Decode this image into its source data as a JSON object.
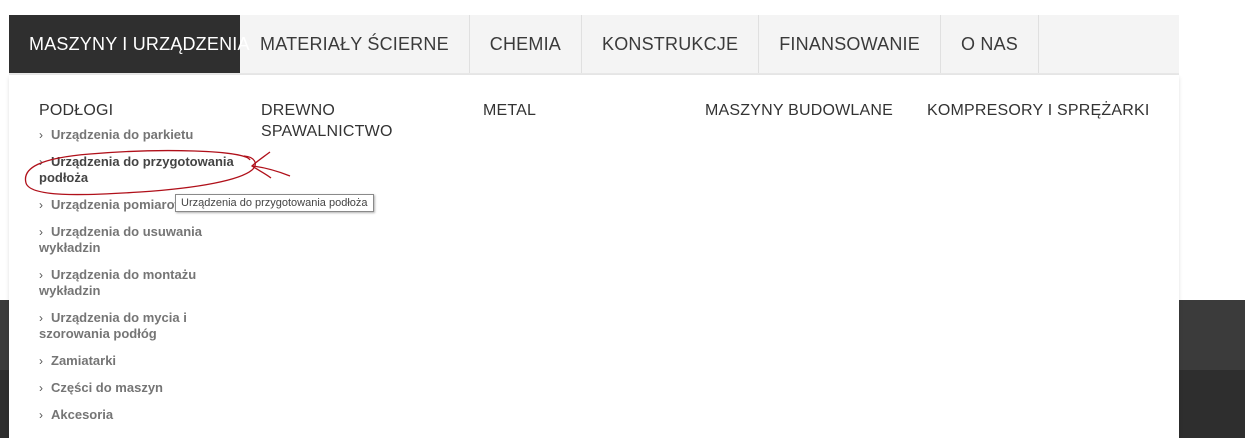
{
  "nav": {
    "items": [
      {
        "label": "MASZYNY I URZĄDZENIA",
        "active": true
      },
      {
        "label": "MATERIAŁY ŚCIERNE",
        "active": false
      },
      {
        "label": "CHEMIA",
        "active": false
      },
      {
        "label": "KONSTRUKCJE",
        "active": false
      },
      {
        "label": "FINANSOWANIE",
        "active": false
      },
      {
        "label": "O NAS",
        "active": false
      }
    ]
  },
  "dropdown": {
    "col1": {
      "title": "PODŁOGI",
      "items": [
        "Urządzenia do parkietu",
        "Urządzenia do przygotowania podłoża",
        "Urządzenia pomiarowe",
        "Urządzenia do usuwania wykładzin",
        "Urządzenia do montażu wykładzin",
        "Urządzenia do mycia i szorowania podłóg",
        "Zamiatarki",
        "Części do maszyn",
        "Akcesoria"
      ]
    },
    "col2": {
      "title": "DREWNO",
      "subtitle": "SPAWALNICTWO"
    },
    "col3": {
      "title": "METAL"
    },
    "col4": {
      "title": "MASZYNY BUDOWLANE"
    },
    "col5": {
      "title": "KOMPRESORY I SPRĘŻARKI"
    }
  },
  "tooltip": {
    "text": "Urządzenia do przygotowania podłoża"
  },
  "colors": {
    "accent_dark": "#2f2f2f",
    "annotation_red": "#b0101a"
  },
  "icons": {
    "list_bullet": "chevron-right-icon"
  }
}
